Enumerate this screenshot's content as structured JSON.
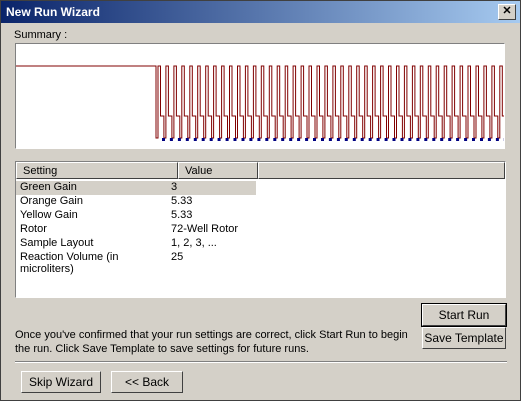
{
  "window": {
    "title": "New Run Wizard",
    "close_glyph": "✕"
  },
  "summary": {
    "label": "Summary :"
  },
  "table": {
    "headers": [
      "Setting",
      "Value"
    ],
    "rows": [
      {
        "setting": "Green Gain",
        "value": "3"
      },
      {
        "setting": "Orange Gain",
        "value": "5.33"
      },
      {
        "setting": "Yellow Gain",
        "value": "5.33"
      },
      {
        "setting": "Rotor",
        "value": "72-Well Rotor"
      },
      {
        "setting": "Sample Layout",
        "value": "1, 2, 3, ..."
      },
      {
        "setting": "Reaction Volume (in microliters)",
        "value": "25"
      }
    ]
  },
  "buttons": {
    "start_run": "Start Run",
    "save_template": "Save Template",
    "skip_wizard": "Skip Wizard",
    "back": "<< Back"
  },
  "info_text": "Once you've confirmed that your run settings are correct, click Start Run to begin the run. Click Save Template to save settings for future runs.",
  "colors": {
    "trace": "#800000",
    "markers": "#000080"
  }
}
